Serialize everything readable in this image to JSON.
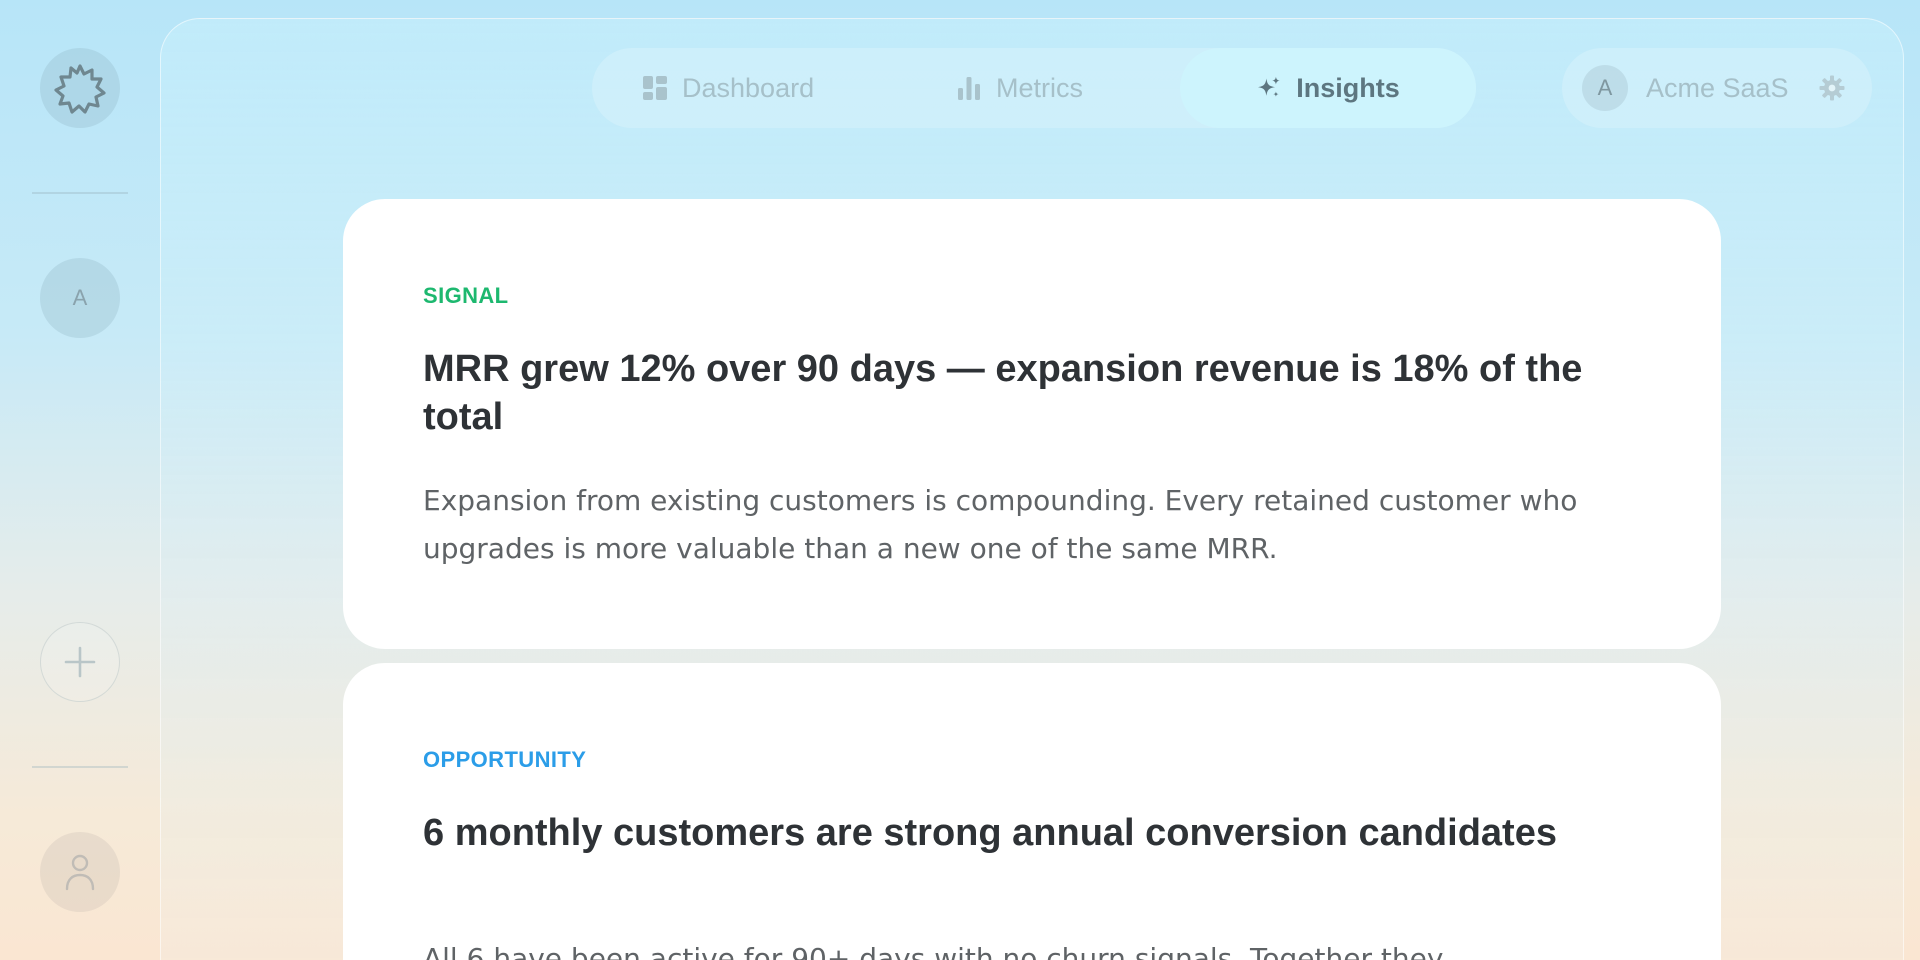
{
  "rail": {
    "logo_icon": "burst-logo-icon",
    "avatar_initial": "A",
    "add_icon": "plus-icon",
    "user_icon": "person-icon"
  },
  "nav": {
    "items": [
      {
        "label": "Dashboard",
        "icon": "dashboard-icon"
      },
      {
        "label": "Metrics",
        "icon": "bar-chart-icon"
      },
      {
        "label": "Insights",
        "icon": "sparkles-icon",
        "active": true
      }
    ]
  },
  "account": {
    "initial": "A",
    "name": "Acme SaaS",
    "settings_icon": "gear-icon"
  },
  "cards": [
    {
      "tag": "SIGNAL",
      "tag_color": "#1db86f",
      "title": "MRR grew 12% over 90 days — expansion revenue is 18% of the total",
      "body": "Expansion from existing customers is compounding. Every retained customer who upgrades is more valuable than a new one of the same MRR."
    },
    {
      "tag": "OPPORTUNITY",
      "tag_color": "#2b9de8",
      "title": "6 monthly customers are strong annual conversion candidates",
      "body": "All 6 have been active for 90+ days with no churn signals. Together they"
    }
  ]
}
